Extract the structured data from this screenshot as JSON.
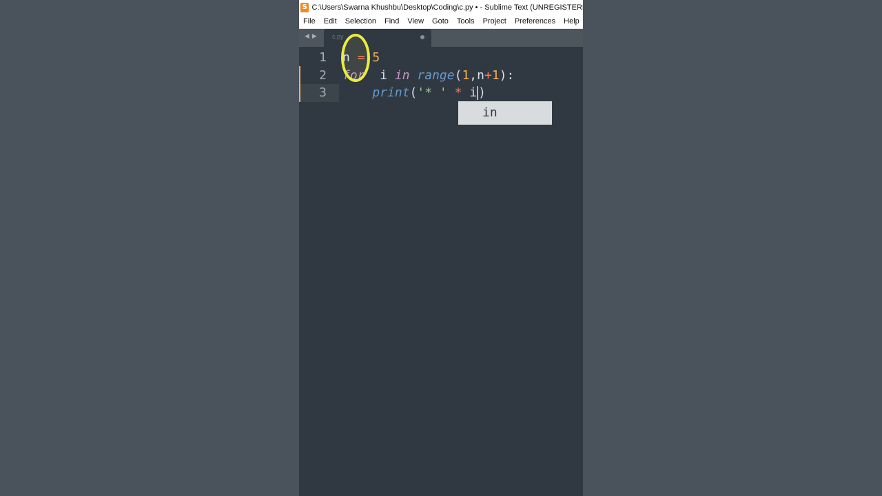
{
  "window": {
    "title": "C:\\Users\\Swarna Khushbu\\Desktop\\Coding\\c.py • - Sublime Text (UNREGISTERED)"
  },
  "menu": [
    "File",
    "Edit",
    "Selection",
    "Find",
    "View",
    "Goto",
    "Tools",
    "Project",
    "Preferences",
    "Help"
  ],
  "tab": {
    "label": "c.py",
    "modified": true
  },
  "editor": {
    "line_numbers": [
      "1",
      "2",
      "3"
    ],
    "lines": [
      [
        {
          "t": "n",
          "c": "var"
        },
        {
          "t": " ",
          "c": "var"
        },
        {
          "t": "=",
          "c": "op"
        },
        {
          "t": " ",
          "c": "var"
        },
        {
          "t": "5",
          "c": "num"
        }
      ],
      [
        {
          "t": "for",
          "c": "kw"
        },
        {
          "t": "  i ",
          "c": "var"
        },
        {
          "t": "in",
          "c": "kw"
        },
        {
          "t": " ",
          "c": "var"
        },
        {
          "t": "range",
          "c": "fn"
        },
        {
          "t": "(",
          "c": "punc"
        },
        {
          "t": "1",
          "c": "num"
        },
        {
          "t": ",",
          "c": "punc"
        },
        {
          "t": "n",
          "c": "var"
        },
        {
          "t": "+",
          "c": "op"
        },
        {
          "t": "1",
          "c": "num"
        },
        {
          "t": "):",
          "c": "punc"
        }
      ],
      [
        {
          "t": "    ",
          "c": "var"
        },
        {
          "t": "print",
          "c": "fn"
        },
        {
          "t": "(",
          "c": "punc"
        },
        {
          "t": "'",
          "c": "str"
        },
        {
          "t": "* ",
          "c": "str"
        },
        {
          "t": "'",
          "c": "str"
        },
        {
          "t": " ",
          "c": "var"
        },
        {
          "t": "*",
          "c": "op"
        },
        {
          "t": " i",
          "c": "var"
        },
        {
          "t": "|",
          "c": "caret"
        },
        {
          "t": ")",
          "c": "punc"
        }
      ]
    ]
  },
  "autocomplete": {
    "items": [
      "in"
    ]
  },
  "colors": {
    "accent": "#f9ae58",
    "editor_bg": "#303841",
    "highlight_ring": "#ecec3c"
  }
}
